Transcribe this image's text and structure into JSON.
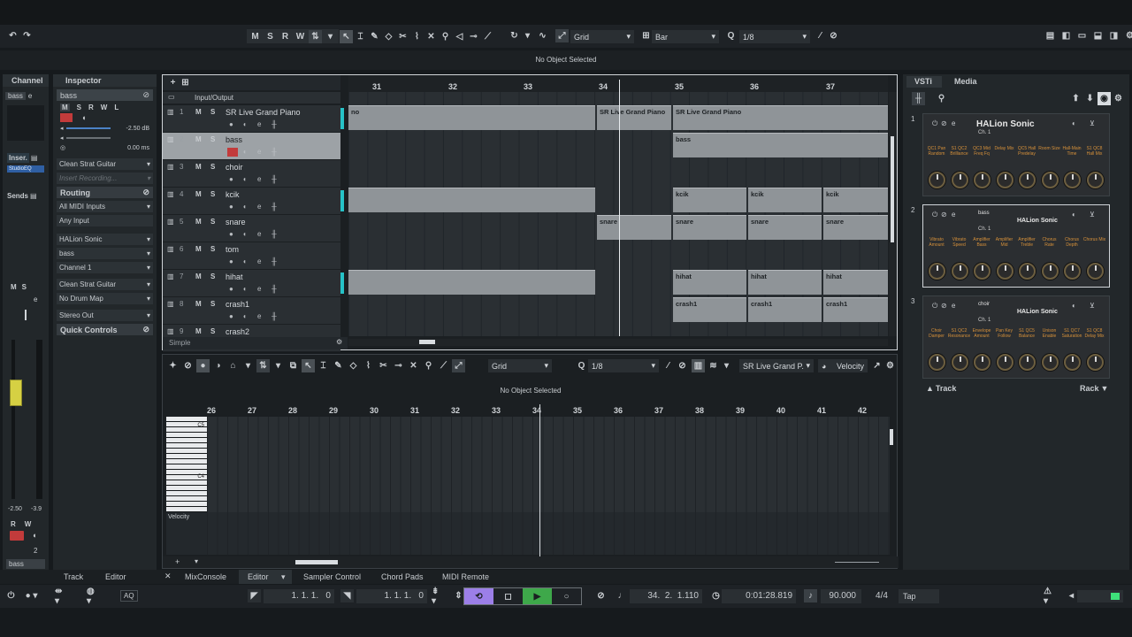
{
  "app": {
    "no_object_selected": "No Object Selected",
    "toolbar": {
      "m": "M",
      "s": "S",
      "r": "R",
      "w": "W",
      "snap_type": "Grid",
      "grid_type": "Bar",
      "quantize": "1/8"
    }
  },
  "channel": {
    "tab": "Channel",
    "track_name": "bass",
    "inserts": "Inser.",
    "insert_plugin": "StudioEQ",
    "sends": "Sends",
    "m": "M",
    "s": "S",
    "r": "R",
    "w": "W",
    "e": "e",
    "level_left": "-2.50",
    "level_right": "-3.9",
    "bottom_name": "bass",
    "bottom_num": "2"
  },
  "inspector": {
    "tab": "Inspector",
    "track_name": "bass",
    "m": "M",
    "s": "S",
    "r": "R",
    "w": "W",
    "l": "L",
    "volume": "-2.50 dB",
    "delay": "0.00 ms",
    "instrument_preset": "Clean Strat Guitar",
    "insert_recording": "Insert Recording...",
    "routing_label": "Routing",
    "midi_in": "All MIDI Inputs",
    "any_input": "Any Input",
    "vsti": "HALion Sonic",
    "vsti_out": "bass",
    "channel": "Channel 1",
    "preset2": "Clean Strat Guitar",
    "drum_map": "No Drum Map",
    "output": "Stereo Out",
    "quick_controls": "Quick Controls"
  },
  "project": {
    "folder": "Input/Output",
    "footer": "Simple",
    "ruler": [
      "31",
      "32",
      "33",
      "34",
      "35",
      "36",
      "37"
    ],
    "tracks": [
      {
        "num": "1",
        "name": "SR Live Grand Piano"
      },
      {
        "num": "2",
        "name": "bass"
      },
      {
        "num": "3",
        "name": "choir"
      },
      {
        "num": "4",
        "name": "kcik"
      },
      {
        "num": "5",
        "name": "snare"
      },
      {
        "num": "6",
        "name": "tom"
      },
      {
        "num": "7",
        "name": "hihat"
      },
      {
        "num": "8",
        "name": "crash1"
      },
      {
        "num": "9",
        "name": "crash2"
      }
    ],
    "parts": {
      "piano_a": "no",
      "piano_b": "SR Live Grand Piano",
      "piano_c": "SR Live Grand Piano",
      "bass": "bass",
      "kick": "kcik",
      "snare": "snare",
      "hihat": "hihat",
      "crash": "crash1"
    }
  },
  "editor": {
    "snap": "Grid",
    "quantize": "1/8",
    "track": "SR Live Grand P.",
    "controller": "Velocity",
    "no_object": "No Object Selected",
    "ruler": [
      "26",
      "27",
      "28",
      "29",
      "30",
      "31",
      "32",
      "33",
      "34",
      "35",
      "36",
      "37",
      "38",
      "39",
      "40",
      "41",
      "42"
    ],
    "c5": "C5",
    "c4": "C4",
    "velocity_lane": "Velocity"
  },
  "vsti_panel": {
    "tab_vsti": "VSTi",
    "tab_media": "Media",
    "slots": [
      {
        "num": "1",
        "name": "",
        "title": "HALion Sonic",
        "ch": "Ch. 1",
        "params": [
          "QC1 Pan Random",
          "S1 QC2 Brilliance",
          "QC3 Mid Freq Fq",
          "Delay Mix",
          "QC5 Hall Predelay",
          "Room Size",
          "Hall-Main Time",
          "S1 QC8 Hall Mix"
        ]
      },
      {
        "num": "2",
        "name": "bass",
        "title": "HALion Sonic",
        "ch": "Ch. 1",
        "params": [
          "Vibrato Amount",
          "Vibrato Speed",
          "Amplifier Bass",
          "Amplifier Mid",
          "Amplifier Treble",
          "Chorus Rate",
          "Chorus Depth",
          "Chorus Mix"
        ]
      },
      {
        "num": "3",
        "name": "choir",
        "title": "HALion Sonic",
        "ch": "Ch. 1",
        "params": [
          "Choir Damper",
          "S1 QC2 Resonance",
          "Envelope Amount",
          "Pan Key Follow",
          "S1 QC5 Balance",
          "Unison Enable",
          "S1 QC7 Saturation",
          "S1 QC8 Delay Mix"
        ]
      }
    ],
    "footer_track": "Track",
    "footer_rack": "Rack"
  },
  "bottom_tabs": {
    "track": "Track",
    "editor": "Editor",
    "mixconsole": "MixConsole",
    "editor2": "Editor",
    "sampler": "Sampler Control",
    "chord_pads": "Chord Pads",
    "midi_remote": "MIDI Remote"
  },
  "transport": {
    "aq": "AQ",
    "left_locator": "1. 1. 1.   0",
    "right_locator": "1. 1. 1.   0",
    "position": "34.  2.  1.110",
    "time": "0:01:28.819",
    "tempo": "90.000",
    "signature": "4/4",
    "tap": "Tap"
  }
}
